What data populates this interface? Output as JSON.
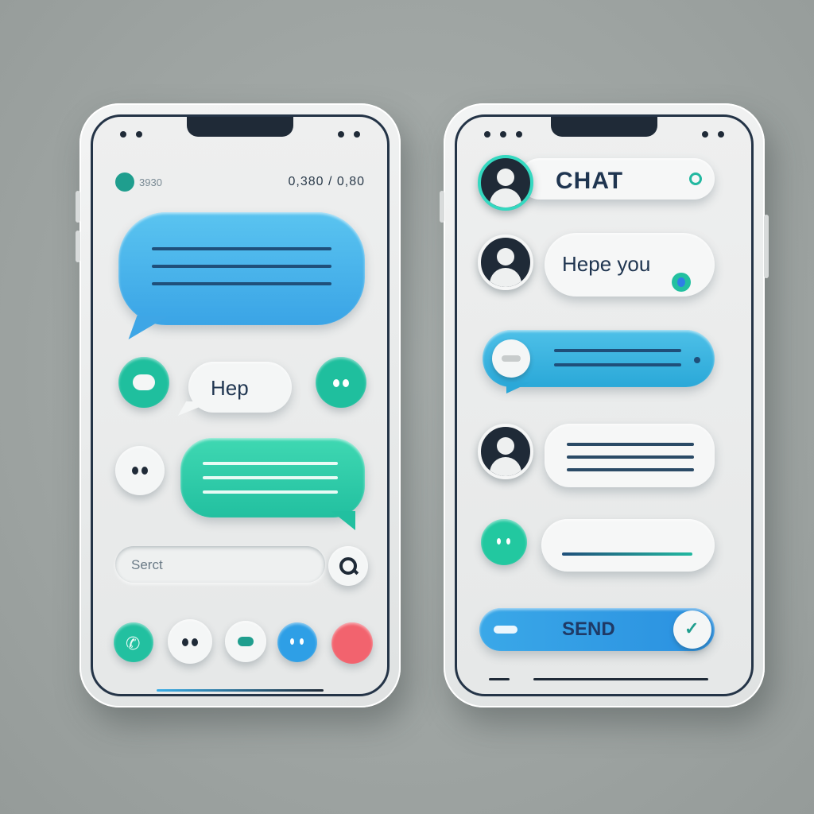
{
  "left_phone": {
    "status_left": "3930",
    "status_right": "0,380 / 0,80",
    "help_bubble_text": "Hep",
    "search": {
      "placeholder": "Serct"
    }
  },
  "right_phone": {
    "chat_title": "CHAT",
    "message_text": "Hepe you",
    "send_label": "SEND"
  },
  "colors": {
    "blue": "#3aaee8",
    "teal": "#22c8a8",
    "cyan": "#2ab3d8",
    "red": "#f2636e",
    "navy": "#1f2a37"
  }
}
